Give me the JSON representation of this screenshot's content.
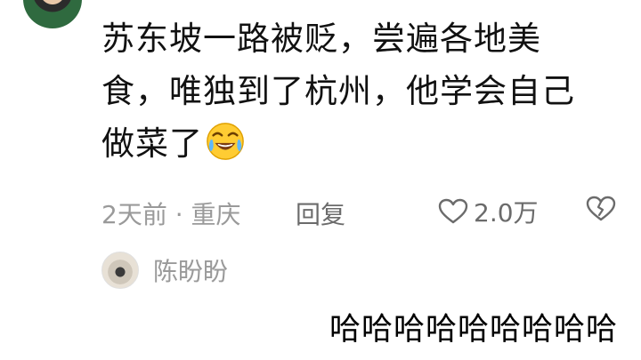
{
  "comment": {
    "lines": [
      "苏东坡一路被贬，尝遍各地美",
      "食，唯独到了杭州，他学会自己",
      "做菜了"
    ],
    "emoji_icon": "crying-laughing-face-icon",
    "time_location": "2天前 · 重庆",
    "reply_label": "回复",
    "like_count": "2.0万"
  },
  "reply": {
    "username": "陈盼盼"
  },
  "caption": "哈哈哈哈哈哈哈哈哈",
  "colors": {
    "text_primary": "#111111",
    "text_secondary": "#9a9a9a",
    "text_action": "#6b6b6b",
    "background": "#ffffff"
  }
}
